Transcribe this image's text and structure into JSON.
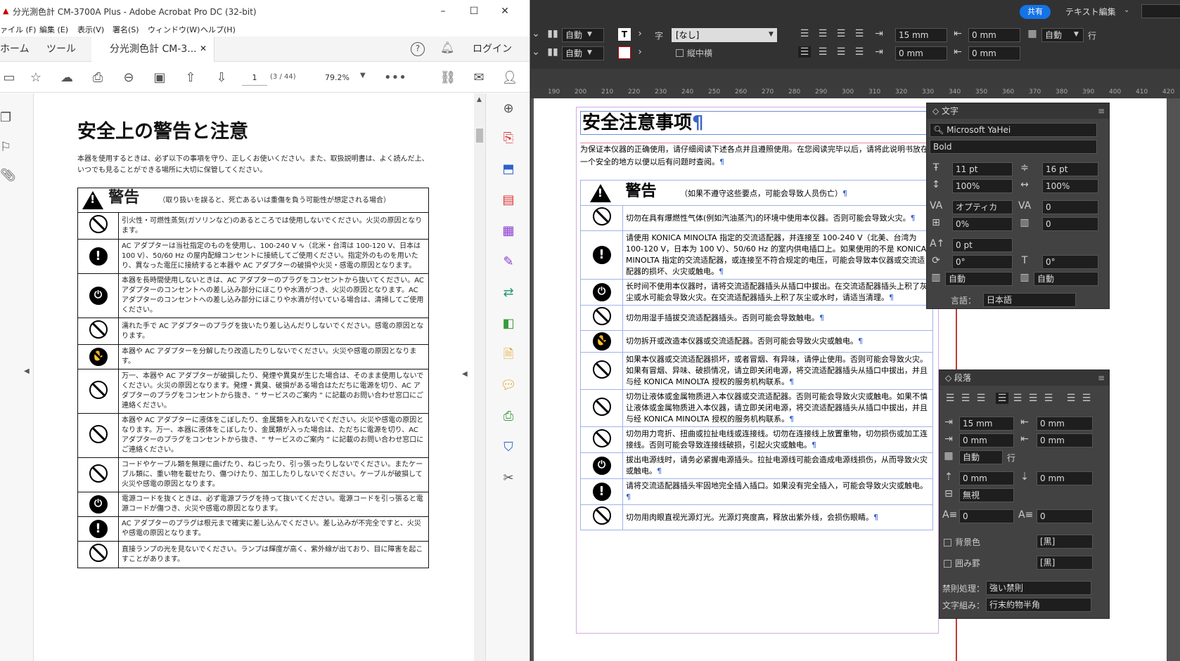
{
  "acrobat": {
    "window_title": "分光測色計 CM-3700A Plus - Adobe Acrobat Pro DC (32-bit)",
    "menu": [
      "ァイル (F)",
      "編集 (E)",
      "表示(V)",
      "署名(S)",
      "ウィンドウ(W)",
      "ヘルプ(H)"
    ],
    "tabs": {
      "home": "ホーム",
      "tools": "ツール",
      "doc": "分光測色計 CM-3...",
      "login": "ログイン"
    },
    "page_current": "1",
    "page_total": "(3 / 44)",
    "zoom": "79.2%",
    "doc": {
      "title": "安全上の警告と注意",
      "intro": "本器を使用するときは、必ず以下の事項を守り、正しくお使いください。また、取扱説明書は、よく読んだ上、いつでも見ることができる場所に大切に保管してください。",
      "warning_label": "警告",
      "warning_desc": "（取り扱いを誤ると、死亡あるいは重傷を負う可能性が想定される場合）",
      "rows": [
        {
          "icon": "prohibit",
          "text": "引火性・可燃性蒸気(ガソリンなど)のあるところでは使用しないでください。火災の原因となります。"
        },
        {
          "icon": "mandatory",
          "text": "AC アダプターは当社指定のものを使用し、100-240 V ∿（北米・台湾は 100-120 V、日本は 100 V）、50/60 Hz の屋内配線コンセントに接続してご使用ください。指定外のものを用いたり、異なった電圧に接続すると本器や AC アダプターの破損や火災・感電の原因となります。"
        },
        {
          "icon": "unplug",
          "text": "本器を長時間使用しないときは、AC アダプターのプラグをコンセントから抜いてください。AC アダプターのコンセントへの差し込み部分にほこりや水滴がつき、火災の原因となります。AC アダプターのコンセントへの差し込み部分にほこりや水滴が付いている場合は、清掃してご使用ください。"
        },
        {
          "icon": "prohibit",
          "text": "濡れた手で AC アダプターのプラグを抜いたり差し込んだりしないでください。感電の原因となります。"
        },
        {
          "icon": "disassemble",
          "text": "本器や AC アダプターを分解したり改造したりしないでください。火災や感電の原因となります。"
        },
        {
          "icon": "prohibit",
          "text": "万一、本器や AC アダプターが破損したり、発煙や異臭が生じた場合は、そのまま使用しないでください。火災の原因となります。発煙・異臭、破損がある場合はただちに電源を切り、AC アダプターのプラグをコンセントから抜き、“ サービスのご案内 ” に記載のお問い合わせ窓口にご連絡ください。"
        },
        {
          "icon": "prohibit",
          "text": "本器や AC アダプターに液体をこぼしたり、金属類を入れないでください。火災や感電の原因となります。万一、本器に液体をこぼしたり、金属類が入った場合は、ただちに電源を切り、AC アダプターのプラグをコンセントから抜き、“ サービスのご案内 ” に記載のお問い合わせ窓口にご連絡ください。"
        },
        {
          "icon": "prohibit",
          "text": "コードやケーブル類を無理に曲げたり、ねじったり、引っ張ったりしないでください。またケーブル類に、重い物を載せたり、傷つけたり、加工したりしないでください。ケーブルが破損して火災や感電の原因となります。"
        },
        {
          "icon": "unplug",
          "text": "電源コードを抜くときは、必ず電源プラグを持って抜いてください。電源コードを引っ張ると電源コードが傷つき、火災や感電の原因となります。"
        },
        {
          "icon": "mandatory",
          "text": "AC アダプターのプラグは根元まで確実に差し込んでください。差し込みが不完全ですと、火災や感電の原因となります。"
        },
        {
          "icon": "prohibit",
          "text": "直接ランプの光を見ないでください。ランプは輝度が高く、紫外線が出ており、目に障害を起こすことがあります。"
        }
      ]
    }
  },
  "indesign": {
    "share": "共有",
    "workspace": "テキスト編集",
    "control": {
      "auto1": "自動",
      "auto2": "自動",
      "ruby": "[なし]",
      "tate": "縦中横",
      "space_before": "15 mm",
      "space_after": "0 mm",
      "indent_first": "0 mm",
      "indent_left": "0 mm",
      "grid": "自動",
      "row_label": "行"
    },
    "ruler": [
      "190",
      "200",
      "210",
      "220",
      "230",
      "240",
      "250",
      "260",
      "270",
      "280",
      "290",
      "300",
      "310",
      "320",
      "330",
      "340",
      "350",
      "360",
      "370",
      "380",
      "390",
      "400",
      "410",
      "420"
    ],
    "doc": {
      "title": "安全注意事项",
      "intro": "为保证本仪器的正确使用，请仔细阅读下述各点并且遵照使用。在您阅读完毕以后，请将此说明书放在一个安全的地方以便以后有问题时查阅。",
      "warning_label": "警告",
      "warning_desc": "（如果不遵守这些要点，可能会导致人员伤亡）",
      "rows": [
        {
          "icon": "prohibit",
          "text": "切勿在具有爆燃性气体(例如汽油蒸汽)的环境中使用本仪器。否则可能会导致火灾。"
        },
        {
          "icon": "mandatory",
          "text": "请使用 KONICA MINOLTA 指定的交流适配器，并连接至 100-240 V（北美、台湾为 100-120 V，日本为 100 V）、50/60 Hz 的室内供电插口上。如果使用的不是 KONICA MINOLTA 指定的交流适配器，或连接至不符合规定的电压，可能会导致本仪器或交流适配器的损坏、火灾或触电。"
        },
        {
          "icon": "unplug",
          "text": "长时间不使用本仪器时，请将交流适配器插头从插口中拔出。在交流适配器插头上积了灰尘或水可能会导致火灾。在交流适配器插头上积了灰尘或水时，请适当清理。"
        },
        {
          "icon": "prohibit",
          "text": "切勿用湿手插拔交流适配器插头。否则可能会导致触电。"
        },
        {
          "icon": "disassemble",
          "text": "切勿拆开或改造本仪器或交流适配器。否则可能会导致火灾或触电。"
        },
        {
          "icon": "prohibit",
          "text": "如果本仪器或交流适配器损坏，或者冒烟、有异味，请停止使用。否则可能会导致火灾。如果有冒烟、异味、破损情况，请立即关闭电源，将交流适配器插头从插口中拔出，并且与经 KONICA MINOLTA 授权的服务机构联系。"
        },
        {
          "icon": "prohibit",
          "text": "切勿让液体或金属物质进入本仪器或交流适配器。否则可能会导致火灾或触电。如果不慎让液体或金属物质进入本仪器，请立即关闭电源，将交流适配器插头从插口中拔出，并且与经 KONICA MINOLTA 授权的服务机构联系。"
        },
        {
          "icon": "prohibit",
          "text": "切勿用力弯折、扭曲或拉扯电线或连接线。切勿在连接线上放置重物，切勿损伤或加工连接线。否则可能会导致连接线破损，引起火灾或触电。"
        },
        {
          "icon": "unplug",
          "text": "拔出电源线时，请务必紧握电源插头。拉扯电源线可能会造成电源线损伤，从而导致火灾或触电。"
        },
        {
          "icon": "mandatory",
          "text": "请将交流适配器插头牢固地完全插入插口。如果没有完全插入，可能会导致火灾或触电。"
        },
        {
          "icon": "prohibit",
          "text": "切勿用肉眼直视光源灯光。光源灯亮度高，释放出紫外线，会损伤眼睛。"
        }
      ]
    },
    "char_panel": {
      "title": "文字",
      "font": "Microsoft YaHei",
      "style": "Bold",
      "size": "11 pt",
      "leading": "16 pt",
      "vscale": "100%",
      "hscale": "100%",
      "kerning": "オプティカ",
      "tracking": "0",
      "tsume": "0%",
      "aki": "0",
      "baseline": "0 pt",
      "rotate": "0°",
      "skew": "0°",
      "aki_before": "自動",
      "aki_after": "自動",
      "lang_label": "言語：",
      "lang": "日本語"
    },
    "para_panel": {
      "title": "段落",
      "left_indent": "15 mm",
      "right_indent": "0 mm",
      "first_indent": "0 mm",
      "last_indent": "0 mm",
      "grid": "自動",
      "row_label": "行",
      "space_before": "0 mm",
      "space_after": "0 mm",
      "align_grid": "無視",
      "drop_lines": "0",
      "drop_chars": "0",
      "bg_label": "背景色",
      "bg_color": "[黒]",
      "border_label": "囲み罫",
      "border_color": "[黒]",
      "kinsoku_label": "禁則処理：",
      "kinsoku": "強い禁則",
      "mojikumi_label": "文字組み：",
      "mojikumi": "行末約物半角"
    }
  }
}
